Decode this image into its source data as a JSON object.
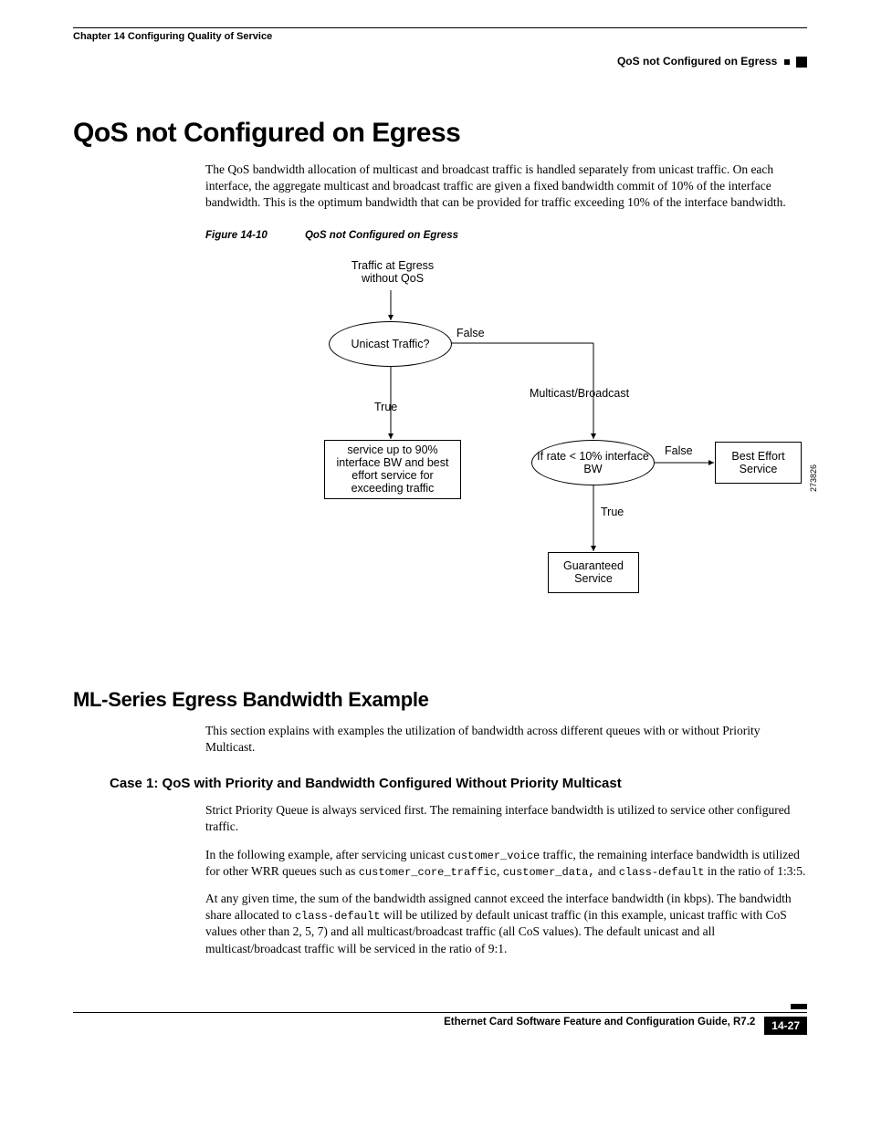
{
  "header": {
    "chapter": "Chapter 14 Configuring Quality of Service",
    "section": "QoS not Configured on Egress"
  },
  "h1": "QoS not Configured on Egress",
  "p1": "The QoS bandwidth allocation of multicast and broadcast traffic is handled separately from unicast traffic. On each interface, the aggregate multicast and broadcast traffic are given a fixed bandwidth commit of 10% of the interface bandwidth. This is the optimum bandwidth that can be provided for traffic exceeding 10% of the interface bandwidth.",
  "figure": {
    "num": "Figure 14-10",
    "title": "QoS not Configured on Egress",
    "id": "273826",
    "labels": {
      "start": "Traffic at Egress without QoS",
      "decision1": "Unicast Traffic?",
      "false1": "False",
      "mcast": "Multicast/Broadcast",
      "true1": "True",
      "box1": "service up to 90% interface BW and best effort service for exceeding traffic",
      "decision2": "If rate < 10% interface BW",
      "false2": "False",
      "box2": "Best Effort Service",
      "true2": "True",
      "box3": "Guaranteed Service"
    }
  },
  "h2": "ML-Series Egress Bandwidth Example",
  "p2": "This section explains with examples the utilization of bandwidth across different queues with or without Priority Multicast.",
  "h3": "Case 1: QoS with Priority and Bandwidth Configured Without Priority Multicast",
  "p3": "Strict Priority Queue is always serviced first. The remaining interface bandwidth is utilized to service other configured traffic.",
  "p4a": "In the following example, after servicing unicast ",
  "p4_code1": "customer_voice",
  "p4b": " traffic, the remaining interface bandwidth is utilized for other WRR queues such as ",
  "p4_code2": "customer_core_traffic",
  "p4c": ", ",
  "p4_code3": "customer_data,",
  "p4d": " and ",
  "p4_code4": "class-default",
  "p4e": " in the ratio of 1:3:5.",
  "p5a": "At any given time, the sum of the bandwidth assigned cannot exceed the interface bandwidth (in kbps). The bandwidth share allocated to ",
  "p5_code1": "class-default",
  "p5b": " will be utilized by default unicast traffic (in this example, unicast traffic with CoS values other than 2, 5, 7) and all multicast/broadcast traffic (all CoS values). The default unicast and all multicast/broadcast traffic will be serviced in the ratio of 9:1.",
  "footer": {
    "title": "Ethernet Card Software Feature and Configuration Guide, R7.2",
    "page": "14-27"
  }
}
